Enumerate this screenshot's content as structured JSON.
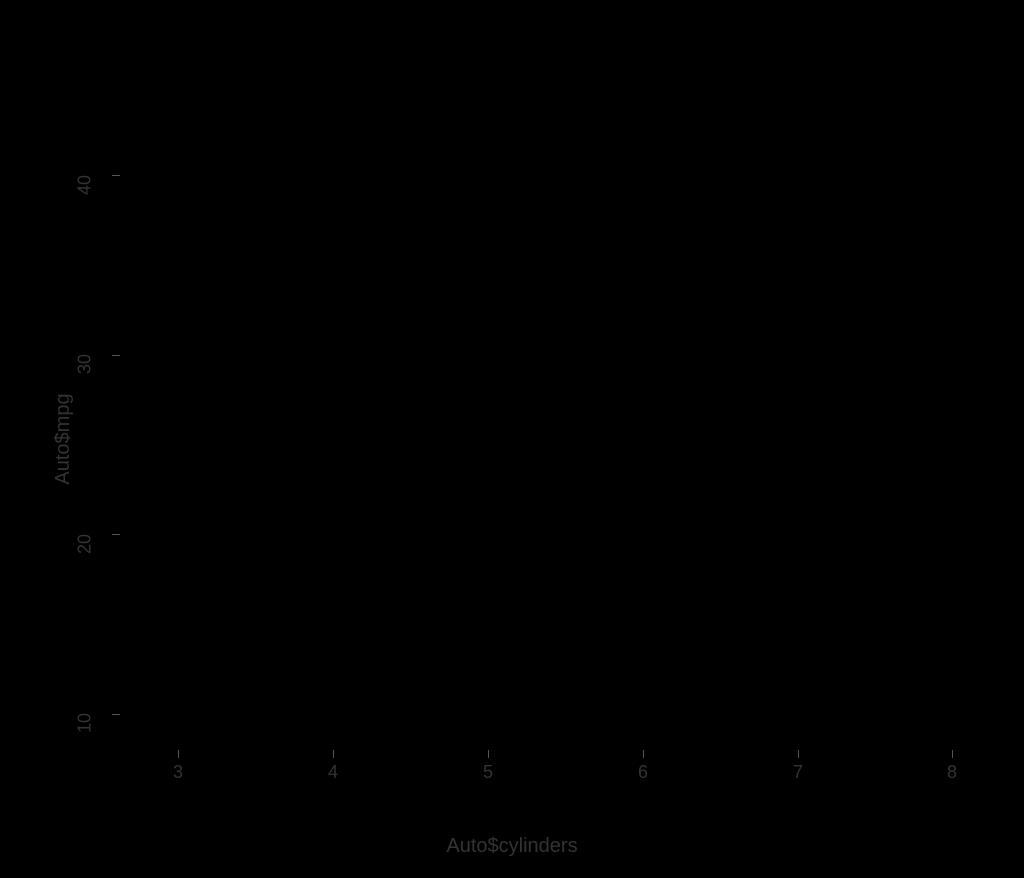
{
  "chart_data": {
    "type": "scatter",
    "title": "",
    "xlabel": "Auto$cylinders",
    "ylabel": "Auto$mpg",
    "xlim": [
      2.5,
      8.5
    ],
    "ylim": [
      8,
      47
    ],
    "x_ticks": [
      3,
      4,
      5,
      6,
      7,
      8
    ],
    "y_ticks": [
      10,
      20,
      30,
      40
    ],
    "note": "Scatter plot area is rendered solid black in the source image; individual points are not distinguishable against the black background."
  }
}
